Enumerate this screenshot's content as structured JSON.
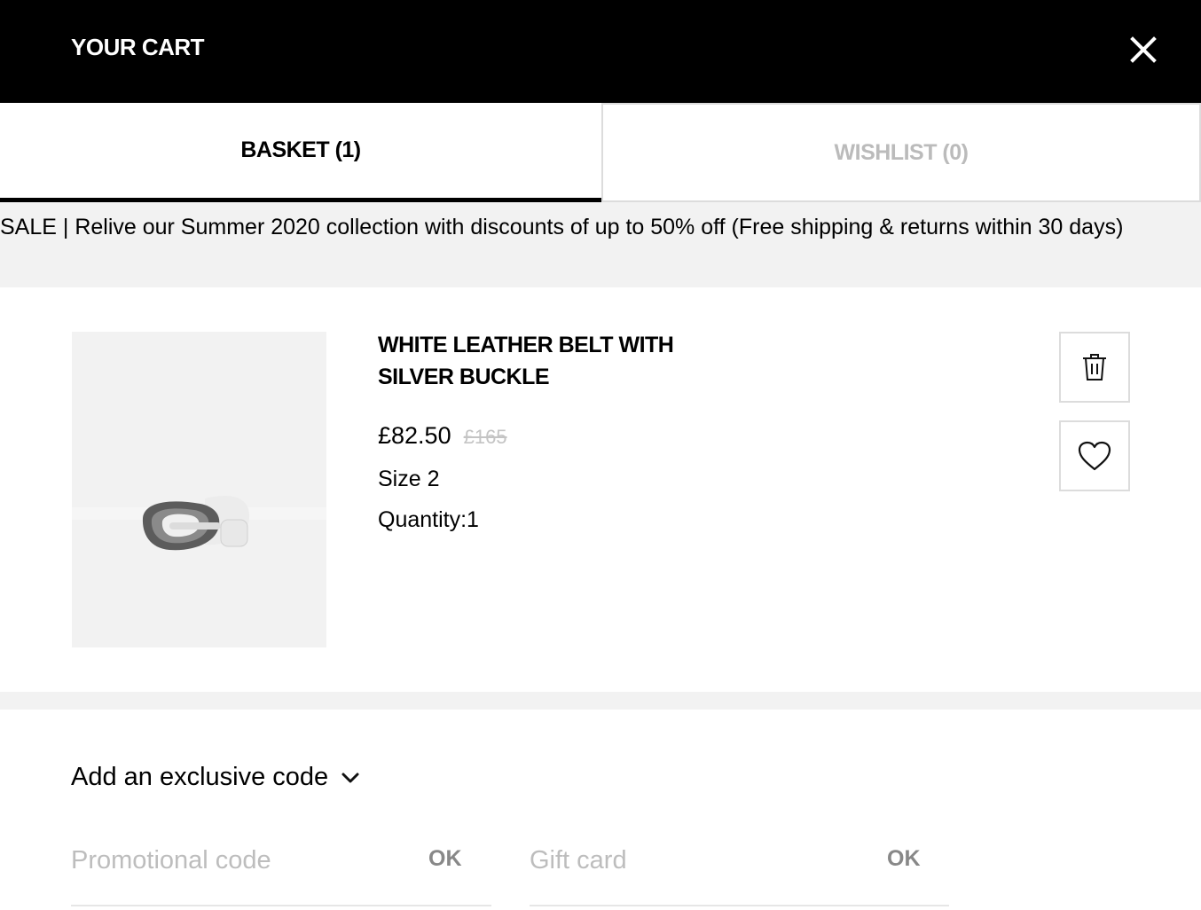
{
  "header": {
    "title": "YOUR CART",
    "close_icon": "close-icon"
  },
  "tabs": [
    {
      "label": "BASKET (1)",
      "active": true
    },
    {
      "label": "WISHLIST (0)",
      "active": false
    }
  ],
  "banner": {
    "text": "SALE | Relive our Summer 2020 collection with discounts of up to 50% off (Free shipping & returns within 30 days)"
  },
  "item": {
    "name": "WHITE LEATHER BELT WITH SILVER BUCKLE",
    "price": "£82.50",
    "original_price": "£165",
    "size": "Size 2",
    "quantity": "Quantity:1",
    "image_icon": "belt-product-image",
    "delete_icon": "trash-icon",
    "wishlist_icon": "heart-icon"
  },
  "codes": {
    "toggle_label": "Add an exclusive code",
    "toggle_icon": "chevron-down-icon",
    "promo": {
      "placeholder": "Promotional code",
      "ok_label": "OK"
    },
    "gift": {
      "placeholder": "Gift card",
      "ok_label": "OK"
    }
  },
  "colors": {
    "header_bg": "#000000",
    "banner_bg": "#f2f2f2",
    "inactive_tab_text": "#bbbbbb",
    "strike_price": "#c4c4c4"
  }
}
